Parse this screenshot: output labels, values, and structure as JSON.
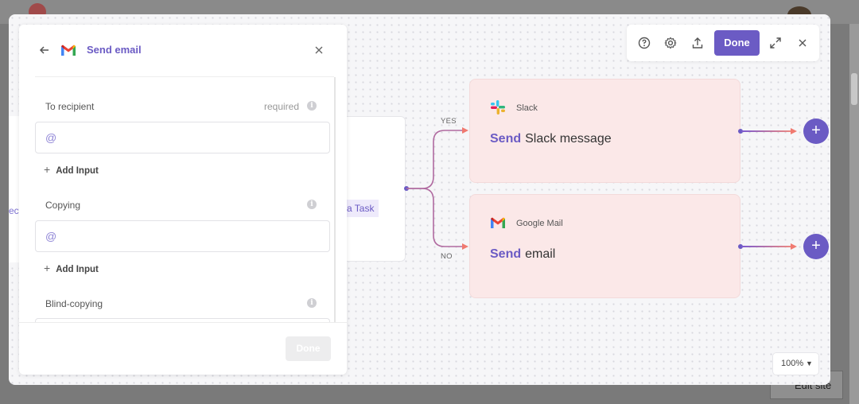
{
  "panel": {
    "title": "Send email",
    "fields": [
      {
        "label": "To recipient",
        "required_text": "required",
        "placeholder": "@"
      },
      {
        "label": "Copying",
        "placeholder": "@"
      },
      {
        "label": "Blind-copying"
      }
    ],
    "add_input_label": "Add Input",
    "done_label": "Done"
  },
  "canvas": {
    "left_node_partial_text": "ect",
    "mid_node_tag_partial": "a Task",
    "branch_yes": "YES",
    "branch_no": "NO",
    "actions": [
      {
        "app": "Slack",
        "verb": "Send",
        "object": "Slack message",
        "icon": "slack-icon"
      },
      {
        "app": "Google Mail",
        "verb": "Send",
        "object": "email",
        "icon": "gmail-icon"
      }
    ],
    "add_step_label": "+"
  },
  "toolbar": {
    "done_label": "Done",
    "icons": [
      "help-icon",
      "settings-icon",
      "upload-icon",
      "expand-icon",
      "close-icon"
    ]
  },
  "zoom": {
    "value": "100%"
  },
  "background": {
    "edit_site_label": "Edit site"
  },
  "colors": {
    "accent": "#6b5bc4",
    "card_bg": "#fbe8e8",
    "canvas_bg": "#f6f6f8"
  }
}
